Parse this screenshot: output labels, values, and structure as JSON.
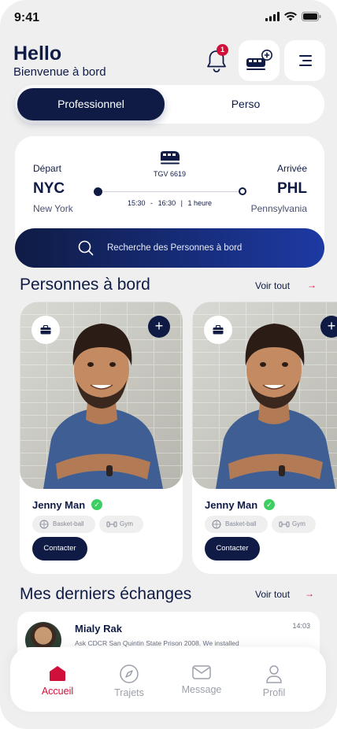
{
  "status_bar": {
    "time": "9:41",
    "signal_icon": "signal-icon",
    "wifi_icon": "wifi-icon",
    "battery_icon": "battery-icon"
  },
  "header": {
    "title": "Hello",
    "subtitle": "Bienvenue à bord",
    "notification_count": "1"
  },
  "segments": {
    "active": "Professionnel",
    "inactive": "Perso"
  },
  "trip": {
    "departure_label": "Départ",
    "departure_code": "NYC",
    "departure_city": "New York",
    "arrival_label": "Arrivée",
    "arrival_code": "PHL",
    "arrival_city": "Pennsylvania",
    "train_number": "TGV 6619",
    "depart_time": "15:30",
    "arrive_time": "16:30",
    "duration": "1 heure",
    "search_placeholder": "Recherche des Personnes à bord"
  },
  "people_section": {
    "title": "Personnes à bord",
    "see_all": "Voir tout",
    "people": [
      {
        "name": "Jenny Man",
        "tags": [
          "Basket-ball",
          "Gym"
        ],
        "contact_label": "Contacter"
      },
      {
        "name": "Jenny Man",
        "tags": [
          "Basket-ball",
          "Gym"
        ],
        "contact_label": "Contacter"
      }
    ]
  },
  "messages_section": {
    "title": "Mes derniers échanges",
    "see_all": "Voir tout",
    "messages": [
      {
        "name": "Mialy Rak",
        "time": "14:03",
        "preview": "Ask CDCR San Quintin State Prison 2008. We installed"
      }
    ]
  },
  "bottom_nav": {
    "items": [
      {
        "label": "Accueil",
        "icon": "home-icon",
        "active": true
      },
      {
        "label": "Trajets",
        "icon": "compass-icon",
        "active": false
      },
      {
        "label": "Message",
        "icon": "mail-icon",
        "active": false
      },
      {
        "label": "Profil",
        "icon": "user-icon",
        "active": false
      }
    ]
  },
  "colors": {
    "navy": "#0f1b45",
    "accent": "#d0103a",
    "background": "#efefef",
    "verified": "#3ecf62"
  }
}
